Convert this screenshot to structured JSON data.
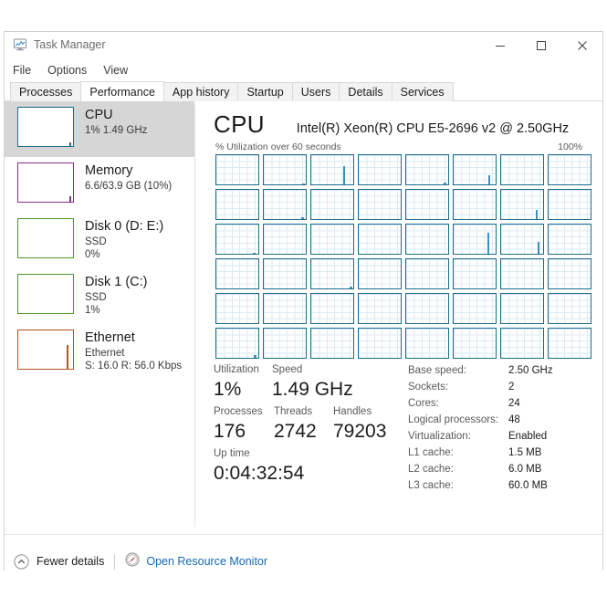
{
  "window": {
    "title": "Task Manager",
    "app_icon": "task-manager-monitor-icon",
    "controls": {
      "minimize": "minimize-icon",
      "maximize": "maximize-icon",
      "close": "close-icon"
    }
  },
  "menu": {
    "items": [
      {
        "label": "File"
      },
      {
        "label": "Options"
      },
      {
        "label": "View"
      }
    ]
  },
  "tabs": [
    {
      "label": "Processes",
      "active": false
    },
    {
      "label": "Performance",
      "active": true
    },
    {
      "label": "App history",
      "active": false
    },
    {
      "label": "Startup",
      "active": false
    },
    {
      "label": "Users",
      "active": false
    },
    {
      "label": "Details",
      "active": false
    },
    {
      "label": "Services",
      "active": false
    }
  ],
  "sidebar": {
    "items": [
      {
        "name": "CPU",
        "line1": "1%  1.49 GHz",
        "line2": "",
        "selected": true,
        "color": "#1d6c8c",
        "spike": {
          "left_pct": 93,
          "height_pct": 9
        }
      },
      {
        "name": "Memory",
        "line1": "6.6/63.9 GB (10%)",
        "line2": "",
        "selected": false,
        "color": "#8a2f8a",
        "spike": {
          "left_pct": 93,
          "height_pct": 14
        }
      },
      {
        "name": "Disk 0 (D: E:)",
        "line1": "SSD",
        "line2": "0%",
        "selected": false,
        "color": "#4c9a2a",
        "spike": {
          "left_pct": 0,
          "height_pct": 0
        }
      },
      {
        "name": "Disk 1 (C:)",
        "line1": "SSD",
        "line2": "1%",
        "selected": false,
        "color": "#4c9a2a",
        "spike": {
          "left_pct": 0,
          "height_pct": 0
        }
      },
      {
        "name": "Ethernet",
        "line1": "Ethernet",
        "line2": "S: 16.0 R: 56.0 Kbps",
        "selected": false,
        "color": "#b4541b",
        "spike": {
          "left_pct": 88,
          "height_pct": 62
        }
      }
    ]
  },
  "cpu_panel": {
    "heading": "CPU",
    "model": "Intel(R) Xeon(R) CPU E5-2696 v2 @ 2.50GHz",
    "graph_caption_left": "% Utilization over 60 seconds",
    "graph_caption_right": "100%",
    "graph_border_color": "#1d6c8c",
    "graph_line_color": "#3f8fbe"
  },
  "chart_data": {
    "type": "line",
    "title": "% Utilization over 60 seconds",
    "subtitle": "Logical processors",
    "xlabel": "60 seconds",
    "ylabel": "% Utilization",
    "ylim": [
      0,
      100
    ],
    "grid": true,
    "legend": "none",
    "panel_count": 48,
    "panel_rows": 6,
    "panel_cols": 8,
    "panels": [
      {
        "index": 0,
        "peak_pct": 0,
        "peak_x_pct": 0
      },
      {
        "index": 1,
        "peak_pct": 4,
        "peak_x_pct": 92
      },
      {
        "index": 2,
        "peak_pct": 62,
        "peak_x_pct": 76
      },
      {
        "index": 3,
        "peak_pct": 0,
        "peak_x_pct": 0
      },
      {
        "index": 4,
        "peak_pct": 6,
        "peak_x_pct": 90
      },
      {
        "index": 5,
        "peak_pct": 30,
        "peak_x_pct": 83
      },
      {
        "index": 6,
        "peak_pct": 0,
        "peak_x_pct": 0
      },
      {
        "index": 7,
        "peak_pct": 0,
        "peak_x_pct": 0
      },
      {
        "index": 8,
        "peak_pct": 0,
        "peak_x_pct": 0
      },
      {
        "index": 9,
        "peak_pct": 7,
        "peak_x_pct": 90
      },
      {
        "index": 10,
        "peak_pct": 0,
        "peak_x_pct": 0
      },
      {
        "index": 11,
        "peak_pct": 0,
        "peak_x_pct": 0
      },
      {
        "index": 12,
        "peak_pct": 0,
        "peak_x_pct": 0
      },
      {
        "index": 13,
        "peak_pct": 0,
        "peak_x_pct": 0
      },
      {
        "index": 14,
        "peak_pct": 32,
        "peak_x_pct": 83
      },
      {
        "index": 15,
        "peak_pct": 0,
        "peak_x_pct": 0
      },
      {
        "index": 16,
        "peak_pct": 4,
        "peak_x_pct": 88
      },
      {
        "index": 17,
        "peak_pct": 0,
        "peak_x_pct": 0
      },
      {
        "index": 18,
        "peak_pct": 0,
        "peak_x_pct": 0
      },
      {
        "index": 19,
        "peak_pct": 0,
        "peak_x_pct": 0
      },
      {
        "index": 20,
        "peak_pct": 0,
        "peak_x_pct": 0
      },
      {
        "index": 21,
        "peak_pct": 72,
        "peak_x_pct": 80
      },
      {
        "index": 22,
        "peak_pct": 40,
        "peak_x_pct": 88
      },
      {
        "index": 23,
        "peak_pct": 0,
        "peak_x_pct": 0
      },
      {
        "index": 24,
        "peak_pct": 0,
        "peak_x_pct": 0
      },
      {
        "index": 25,
        "peak_pct": 0,
        "peak_x_pct": 0
      },
      {
        "index": 26,
        "peak_pct": 6,
        "peak_x_pct": 92
      },
      {
        "index": 27,
        "peak_pct": 0,
        "peak_x_pct": 0
      },
      {
        "index": 28,
        "peak_pct": 0,
        "peak_x_pct": 0
      },
      {
        "index": 29,
        "peak_pct": 0,
        "peak_x_pct": 0
      },
      {
        "index": 30,
        "peak_pct": 0,
        "peak_x_pct": 0
      },
      {
        "index": 31,
        "peak_pct": 0,
        "peak_x_pct": 0
      },
      {
        "index": 32,
        "peak_pct": 0,
        "peak_x_pct": 0
      },
      {
        "index": 33,
        "peak_pct": 0,
        "peak_x_pct": 0
      },
      {
        "index": 34,
        "peak_pct": 0,
        "peak_x_pct": 0
      },
      {
        "index": 35,
        "peak_pct": 0,
        "peak_x_pct": 0
      },
      {
        "index": 36,
        "peak_pct": 0,
        "peak_x_pct": 0
      },
      {
        "index": 37,
        "peak_pct": 0,
        "peak_x_pct": 0
      },
      {
        "index": 38,
        "peak_pct": 0,
        "peak_x_pct": 0
      },
      {
        "index": 39,
        "peak_pct": 0,
        "peak_x_pct": 0
      },
      {
        "index": 40,
        "peak_pct": 8,
        "peak_x_pct": 90
      },
      {
        "index": 41,
        "peak_pct": 0,
        "peak_x_pct": 0
      },
      {
        "index": 42,
        "peak_pct": 0,
        "peak_x_pct": 0
      },
      {
        "index": 43,
        "peak_pct": 0,
        "peak_x_pct": 0
      },
      {
        "index": 44,
        "peak_pct": 0,
        "peak_x_pct": 0
      },
      {
        "index": 45,
        "peak_pct": 0,
        "peak_x_pct": 0
      },
      {
        "index": 46,
        "peak_pct": 0,
        "peak_x_pct": 0
      },
      {
        "index": 47,
        "peak_pct": 0,
        "peak_x_pct": 0
      }
    ]
  },
  "stats": {
    "utilization_label": "Utilization",
    "utilization_value": "1%",
    "speed_label": "Speed",
    "speed_value": "1.49 GHz",
    "processes_label": "Processes",
    "processes_value": "176",
    "threads_label": "Threads",
    "threads_value": "2742",
    "handles_label": "Handles",
    "handles_value": "79203",
    "uptime_label": "Up time",
    "uptime_value": "0:04:32:54"
  },
  "specs": [
    {
      "key": "Base speed:",
      "value": "2.50 GHz"
    },
    {
      "key": "Sockets:",
      "value": "2"
    },
    {
      "key": "Cores:",
      "value": "24"
    },
    {
      "key": "Logical processors:",
      "value": "48"
    },
    {
      "key": "Virtualization:",
      "value": "Enabled"
    },
    {
      "key": "L1 cache:",
      "value": "1.5 MB"
    },
    {
      "key": "L2 cache:",
      "value": "6.0 MB"
    },
    {
      "key": "L3 cache:",
      "value": "60.0 MB"
    }
  ],
  "footer": {
    "fewer_details_label": "Fewer details",
    "fewer_details_icon": "chevron-up-circle-icon",
    "resource_monitor_label": "Open Resource Monitor",
    "resource_monitor_icon": "resource-monitor-icon",
    "link_color": "#1468b4"
  }
}
